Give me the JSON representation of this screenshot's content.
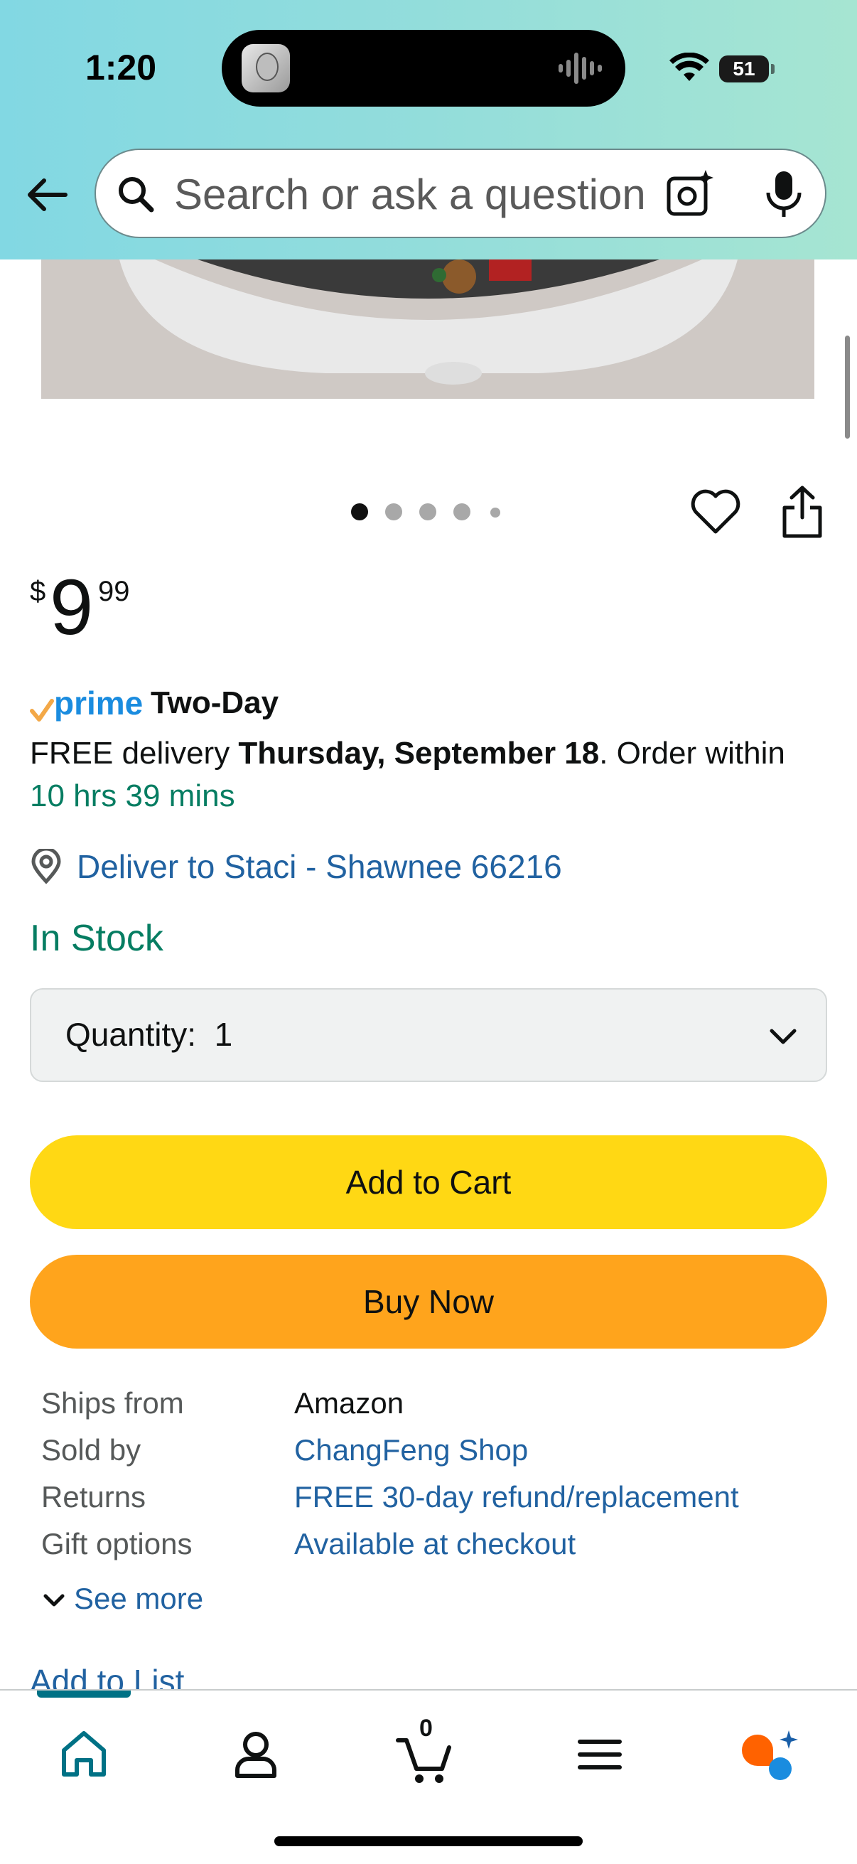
{
  "status_bar": {
    "time": "1:20",
    "battery": "51",
    "icons": [
      "contact-photo-icon",
      "audio-waveform-icon",
      "wifi-icon",
      "battery-icon"
    ]
  },
  "header": {
    "back_icon": "back-arrow-icon",
    "search": {
      "placeholder": "Search or ask a question",
      "icons": [
        "search-icon",
        "camera-lens-icon",
        "microphone-icon"
      ]
    },
    "colors": {
      "gradient_start": "#82d8e3",
      "gradient_end": "#a6e5d2"
    }
  },
  "product": {
    "carousel": {
      "image_count": 5,
      "active_index": 0
    },
    "actions": [
      "heart-icon",
      "share-icon"
    ],
    "price": {
      "symbol": "$",
      "whole": "9",
      "fraction": "99"
    },
    "prime": {
      "badge": "prime",
      "label": "Two-Day"
    },
    "delivery": {
      "prefix": "FREE delivery ",
      "date": "Thursday, September 18",
      "middle": ". Order within ",
      "countdown": "10 hrs 39 mins"
    },
    "deliver_to": "Deliver to Staci - Shawnee 66216",
    "stock": "In Stock",
    "quantity": {
      "label": "Quantity:",
      "value": "1"
    },
    "buttons": {
      "add_to_cart": "Add to Cart",
      "buy_now": "Buy Now"
    },
    "info": [
      {
        "key": "Ships from",
        "value": "Amazon",
        "link": false
      },
      {
        "key": "Sold by",
        "value": "ChangFeng Shop",
        "link": true
      },
      {
        "key": "Returns",
        "value": "FREE 30-day refund/replacement",
        "link": true
      },
      {
        "key": "Gift options",
        "value": "Available at checkout",
        "link": true
      }
    ],
    "see_more": "See more",
    "add_to_list": "Add to List"
  },
  "bottom_nav": {
    "items": [
      "home-icon",
      "account-icon",
      "cart-icon",
      "menu-icon",
      "rufus-icon"
    ],
    "cart_count": "0",
    "active": "home"
  },
  "colors": {
    "link": "#2162a1",
    "green": "#067d62",
    "add_to_cart": "#ffd814",
    "buy_now": "#ffa41c",
    "prime_blue": "#1a8cdf",
    "prime_check": "#f3a847"
  }
}
